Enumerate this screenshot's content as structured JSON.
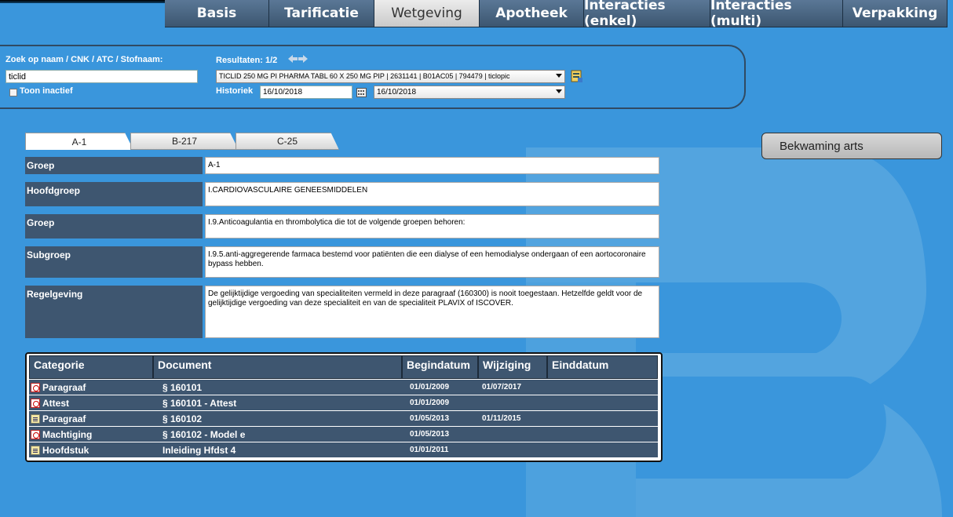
{
  "nav": {
    "tabs": [
      {
        "label": "Basis"
      },
      {
        "label": "Tarificatie"
      },
      {
        "label": "Wetgeving"
      },
      {
        "label": "Apotheek"
      },
      {
        "label": "Interacties (enkel)"
      },
      {
        "label": "Interacties (multi)"
      },
      {
        "label": "Verpakking"
      }
    ],
    "active": "Wetgeving"
  },
  "search": {
    "label": "Zoek op naam / CNK / ATC / Stofnaam:",
    "value": "ticlid",
    "inactive_label": "Toon inactief",
    "results_label": "Resultaten: 1/2",
    "result_selected": "TICLID 250 MG PI PHARMA TABL 60 X 250 MG PIP | 2631141 | B01AC05 | 794479 | ticlopic",
    "history_label": "Historiek",
    "history_date": "16/10/2018",
    "history_select": "16/10/2018"
  },
  "subtabs": [
    {
      "label": "A-1"
    },
    {
      "label": "B-217"
    },
    {
      "label": "C-25"
    }
  ],
  "fields": {
    "groep1": {
      "label": "Groep",
      "value": "A-1"
    },
    "hoofdgroep": {
      "label": "Hoofdgroep",
      "value": "I.CARDIOVASCULAIRE GENEESMIDDELEN"
    },
    "groep2": {
      "label": "Groep",
      "value": "I.9.Anticoagulantia en thrombolytica die tot de volgende groepen behoren:"
    },
    "subgroep": {
      "label": "Subgroep",
      "value": "I.9.5.anti-aggregerende farmaca bestemd voor patiënten die een dialyse of een hemodialyse ondergaan of een aortocoronaire bypass hebben."
    },
    "regelgeving": {
      "label": "Regelgeving",
      "value": "De gelijktijdige vergoeding van specialiteiten vermeld in deze paragraaf (160300) is nooit toegestaan. Hetzelfde geldt voor de gelijktijdige vergoeding van deze specialiteit en van de specialiteit PLAVIX of ISCOVER."
    }
  },
  "bekwaming_button": "Bekwaming arts",
  "table": {
    "headers": [
      "Categorie",
      "Document",
      "Begindatum",
      "Wijziging",
      "Einddatum"
    ],
    "rows": [
      {
        "icon": "pdf-icon",
        "categorie": "Paragraaf",
        "document": "§ 160101",
        "begindatum": "01/01/2009",
        "wijziging": "01/07/2017",
        "einddatum": ""
      },
      {
        "icon": "pdf-icon",
        "categorie": "Attest",
        "document": "§ 160101 - Attest",
        "begindatum": "01/01/2009",
        "wijziging": "",
        "einddatum": ""
      },
      {
        "icon": "document-icon",
        "categorie": "Paragraaf",
        "document": "§ 160102",
        "begindatum": "01/05/2013",
        "wijziging": "01/11/2015",
        "einddatum": ""
      },
      {
        "icon": "pdf-icon",
        "categorie": "Machtiging",
        "document": "§ 160102 - Model e",
        "begindatum": "01/05/2013",
        "wijziging": "",
        "einddatum": ""
      },
      {
        "icon": "document-icon",
        "categorie": "Hoofdstuk",
        "document": "Inleiding Hfdst 4",
        "begindatum": "01/01/2011",
        "wijziging": "",
        "einddatum": ""
      }
    ]
  },
  "colors": {
    "background": "#3a96dc",
    "panel_dark": "#3e5670",
    "tab_active": "#e0e0e0"
  }
}
